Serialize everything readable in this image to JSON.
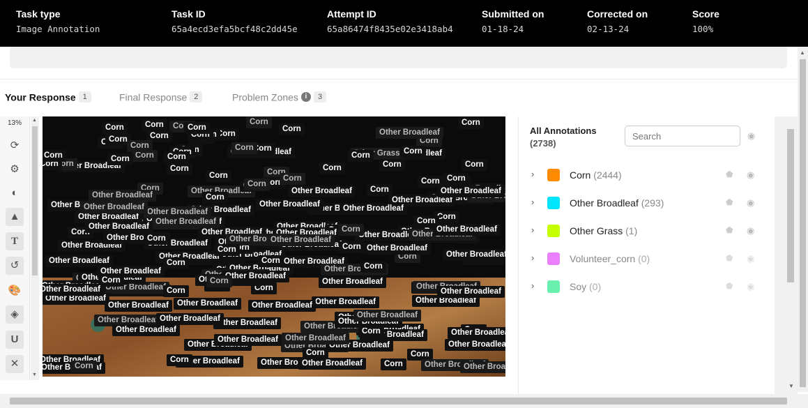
{
  "header": {
    "columns": [
      {
        "label": "Task type",
        "value": "Image Annotation"
      },
      {
        "label": "Task ID",
        "value": "65a4ecd3efa5bcf48c2dd45e"
      },
      {
        "label": "Attempt ID",
        "value": "65a86474f8435e02e3418ab4"
      },
      {
        "label": "Submitted on",
        "value": "01-18-24"
      },
      {
        "label": "Corrected on",
        "value": "02-13-24"
      },
      {
        "label": "Score",
        "value": "100%"
      }
    ]
  },
  "tabs": [
    {
      "label": "Your Response",
      "count": "1",
      "active": true
    },
    {
      "label": "Final Response",
      "count": "2",
      "active": false
    },
    {
      "label": "Problem Zones",
      "count": "3",
      "active": false
    }
  ],
  "toolbar": {
    "zoom": "13%",
    "tools": [
      "refresh-icon",
      "settings-icon",
      "contrast-icon",
      "shapes-icon",
      "text-icon",
      "history-icon",
      "palette-icon",
      "fill-icon",
      "magnet-icon",
      "collapse-icon"
    ]
  },
  "canvas": {
    "labels": [
      "Corn",
      "Other Broadleaf",
      "Other Grass"
    ]
  },
  "annotations_panel": {
    "title": "All Annotations",
    "total": "(2738)",
    "search_placeholder": "Search",
    "classes": [
      {
        "name": "Corn",
        "count": "(2444)",
        "color": "#FF8C00"
      },
      {
        "name": "Other Broadleaf",
        "count": "(293)",
        "color": "#00E5FF"
      },
      {
        "name": "Other Grass",
        "count": "(1)",
        "color": "#C6FF00"
      },
      {
        "name": "Volunteer_corn",
        "count": "(0)",
        "color": "#EA80FC"
      },
      {
        "name": "Soy",
        "count": "(0)",
        "color": "#69F0AE"
      }
    ]
  }
}
